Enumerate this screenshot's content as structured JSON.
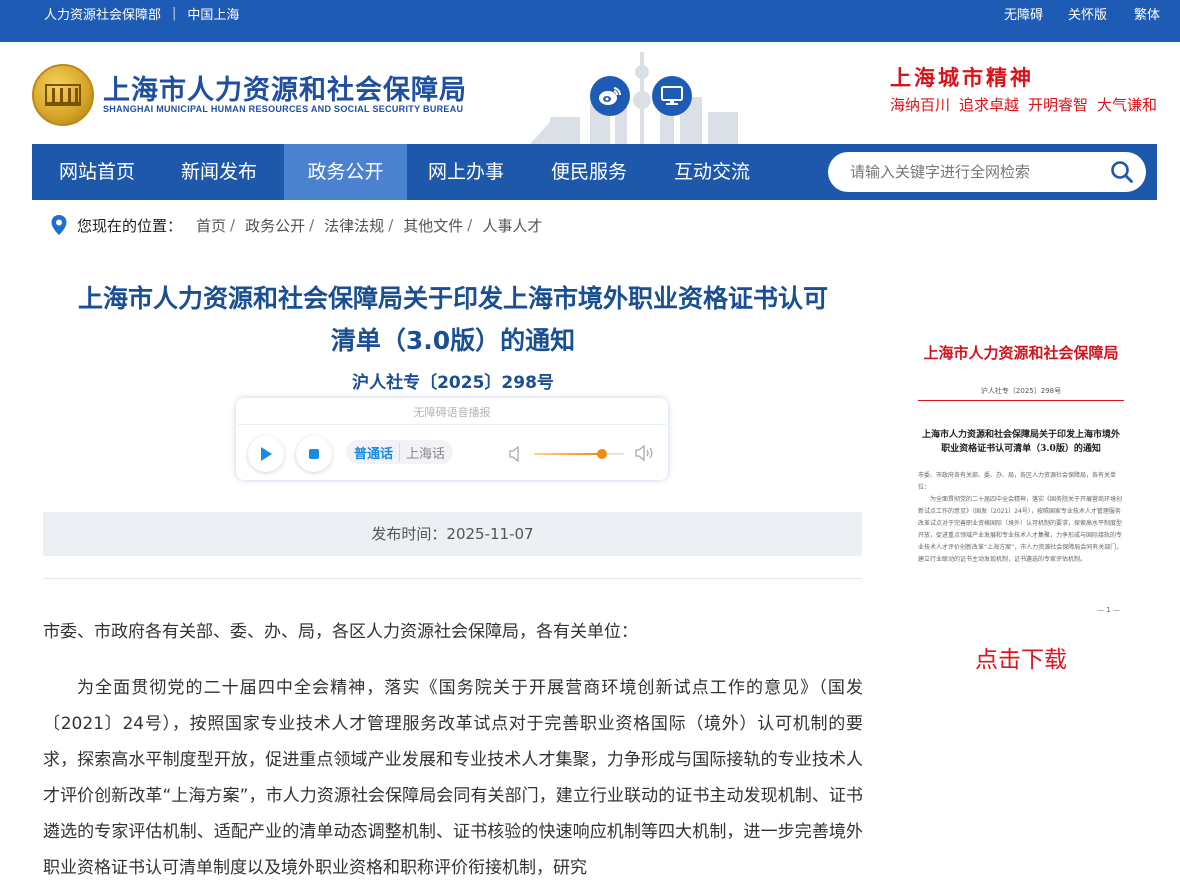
{
  "topbar": {
    "left_link": "人力资源社会保障部",
    "right_link": "中国上海",
    "accessibility": "无障碍",
    "care": "关怀版",
    "traditional": "繁体"
  },
  "header": {
    "title": "上海市人力资源和社会保障局",
    "subtitle": "SHANGHAI MUNICIPAL HUMAN RESOURCES AND SOCIAL SECURITY BUREAU",
    "spirit_title": "上海城市精神",
    "spirit_words": [
      "海纳百川",
      "追求卓越",
      "开明睿智",
      "大气谦和"
    ],
    "icons": [
      "weibo-icon",
      "monitor-icon"
    ]
  },
  "nav": {
    "items": [
      "网站首页",
      "新闻发布",
      "政务公开",
      "网上办事",
      "便民服务",
      "互动交流"
    ],
    "active": "政务公开",
    "search_placeholder": "请输入关键字进行全网检索"
  },
  "breadcrumb": {
    "label": "您现在的位置：",
    "items": [
      "首页",
      "政务公开",
      "法律法规",
      "其他文件",
      "人事人才"
    ],
    "separator": "/"
  },
  "article": {
    "title_line1": "上海市人力资源和社会保障局关于印发上海市境外职业资格证书认可",
    "title_line2": "清单（3.0版）的通知",
    "doc_number": "沪人社专〔2025〕298号",
    "player": {
      "caption": "无障碍语音播报",
      "lang_selected": "普通话",
      "lang_other": "上海话",
      "volume": 0.75
    },
    "publish_time": "发布时间：2025-11-07",
    "greeting": "市委、市政府各有关部、委、办、局，各区人力资源社会保障局，各有关单位：",
    "paragraph1": "为全面贯彻党的二十届四中全会精神，落实《国务院关于开展营商环境创新试点工作的意见》（国发〔2021〕24号），按照国家专业技术人才管理服务改革试点对于完善职业资格国际（境外）认可机制的要求，探索高水平制度型开放，促进重点领域产业发展和专业技术人才集聚，力争形成与国际接轨的专业技术人才评价创新改革“上海方案”，市人力资源社会保障局会同有关部门，建立行业联动的证书主动发现机制、证书遴选的专家评估机制、适配产业的清单动态调整机制、证书核验的快速响应机制等四大机制，进一步完善境外职业资格证书认可清单制度以及境外职业资格和职称评价衔接机制，研究"
  },
  "sidebar": {
    "doc_header": "上海市人力资源和社会保障局",
    "doc_no": "沪人社专〔2025〕298号",
    "doc_title": "上海市人力资源和社会保障局关于印发上海市境外职业资格证书认可清单（3.0版）的通知",
    "doc_greeting": "市委、市政府各有关部、委、办、局，各区人力资源社会保障局，各有关单位：",
    "doc_body": "为全面贯彻党的二十届四中全会精神，落实《国务院关于开展营商环境创新试点工作的意见》（国发〔2021〕24号），按照国家专业技术人才管理服务改革试点对于完善职业资格国际（境外）认可机制的要求，探索高水平制度型开放，促进重点领域产业发展和专业技术人才集聚，力争形成与国际接轨的专业技术人才评价创新改革“上海方案”，市人力资源社会保障局会同有关部门，建立行业联动的证书主动发现机制，证书遴选的专家评估机制。",
    "doc_page": "— 1 —",
    "download": "点击下载"
  }
}
